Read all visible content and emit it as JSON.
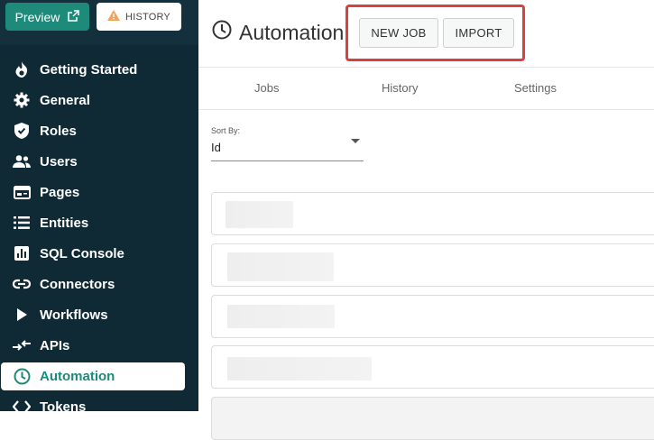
{
  "sidebar": {
    "preview_label": "Preview",
    "history_label": "HISTORY",
    "items": [
      {
        "label": "Getting Started",
        "icon": "flame-icon"
      },
      {
        "label": "General",
        "icon": "gear-icon"
      },
      {
        "label": "Roles",
        "icon": "shield-check-icon"
      },
      {
        "label": "Users",
        "icon": "users-icon"
      },
      {
        "label": "Pages",
        "icon": "pages-icon"
      },
      {
        "label": "Entities",
        "icon": "list-icon"
      },
      {
        "label": "SQL Console",
        "icon": "chart-icon"
      },
      {
        "label": "Connectors",
        "icon": "link-icon"
      },
      {
        "label": "Workflows",
        "icon": "play-icon"
      },
      {
        "label": "APIs",
        "icon": "arrows-icon"
      },
      {
        "label": "Automation",
        "icon": "clock-icon",
        "active": true
      },
      {
        "label": "Tokens",
        "icon": "code-icon"
      }
    ]
  },
  "header": {
    "title": "Automation",
    "new_job_label": "NEW JOB",
    "import_label": "IMPORT"
  },
  "tabs": [
    {
      "label": "Jobs"
    },
    {
      "label": "History"
    },
    {
      "label": "Settings"
    }
  ],
  "sort": {
    "label": "Sort By:",
    "value": "Id"
  },
  "colors": {
    "sidebar_bg": "#0f2a35",
    "accent": "#1e8a7a",
    "highlight": "#d94040"
  }
}
